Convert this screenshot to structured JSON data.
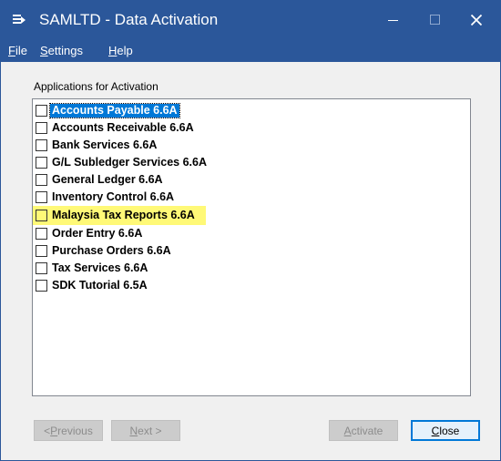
{
  "window": {
    "title": "SAMLTD - Data Activation",
    "accent": "#2b579a"
  },
  "menu": {
    "file": {
      "mnemonic": "F",
      "rest": "ile"
    },
    "settings": {
      "mnemonic": "S",
      "rest": "ettings"
    },
    "help": {
      "mnemonic": "H",
      "rest": "elp"
    }
  },
  "group_label": "Applications for Activation",
  "applications": [
    {
      "label": "Accounts Payable 6.6A",
      "checked": false,
      "selected": true
    },
    {
      "label": "Accounts Receivable 6.6A",
      "checked": false
    },
    {
      "label": "Bank Services 6.6A",
      "checked": false
    },
    {
      "label": "G/L Subledger Services 6.6A",
      "checked": false
    },
    {
      "label": "General Ledger 6.6A",
      "checked": false
    },
    {
      "label": "Inventory Control 6.6A",
      "checked": false
    },
    {
      "label": "Malaysia Tax Reports 6.6A",
      "checked": false,
      "highlighted": true,
      "highlight_color": "#fff977"
    },
    {
      "label": "Order Entry 6.6A",
      "checked": false
    },
    {
      "label": "Purchase Orders 6.6A",
      "checked": false
    },
    {
      "label": "Tax Services 6.6A",
      "checked": false
    },
    {
      "label": "SDK Tutorial 6.5A",
      "checked": false
    }
  ],
  "buttons": {
    "previous": {
      "pre": "< ",
      "mnemonic": "P",
      "rest": "revious",
      "enabled": false
    },
    "next": {
      "pre": "",
      "mnemonic": "N",
      "rest": "ext >",
      "enabled": false
    },
    "activate": {
      "pre": "",
      "mnemonic": "A",
      "rest": "ctivate",
      "enabled": false
    },
    "close": {
      "pre": "",
      "mnemonic": "C",
      "rest": "lose",
      "enabled": true
    }
  }
}
